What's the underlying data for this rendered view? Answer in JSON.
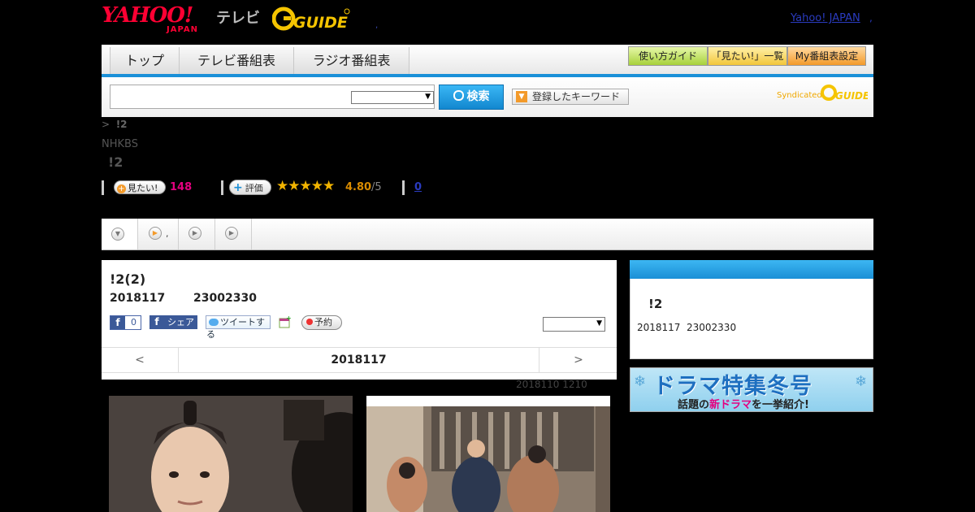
{
  "header": {
    "logo_main": "YAHOO!",
    "logo_sub": "JAPAN",
    "tv_label": "テレビ",
    "gguide_logo": "G GUIDE",
    "dot": ",",
    "yahoo_link": "Yahoo! JAPAN",
    "yahoo_link_dot": ","
  },
  "nav": {
    "tabs": [
      "トップ",
      "テレビ番組表",
      "ラジオ番組表"
    ],
    "buttons": [
      "使い方ガイド",
      "「見たい!」一覧",
      "My番組表設定"
    ]
  },
  "search": {
    "button_label": "検索",
    "keyword_button": "登録したキーワード",
    "syndicated": "Syndicated"
  },
  "breadcrumb": {
    "arrow": ">",
    "current": "!2"
  },
  "program": {
    "channel": "NHKBS",
    "title": "!2",
    "want_label": "見たい!",
    "want_count": "148",
    "rate_label": "評価",
    "stars": "★★★★★",
    "rating": "4.80",
    "rating_max": "/5",
    "zero_link": "0"
  },
  "tabs": {
    "tab2_label": ","
  },
  "episode": {
    "title": "!2(2)",
    "date": "2018117",
    "time": "23002330",
    "fb_count": "0",
    "fb_share": "シェア",
    "tweet": "ツイートする",
    "reserve": "予約",
    "nav_prev": "<",
    "nav_date": "2018117",
    "nav_next": ">",
    "update_note": "2018110  1210"
  },
  "side": {
    "title": "!2",
    "date": "2018117",
    "time": "23002330"
  },
  "banner": {
    "main": "ドラマ特集冬号",
    "sub_pre": "話題の",
    "sub_em": "新ドラマ",
    "sub_post": "を一挙紹介!"
  }
}
